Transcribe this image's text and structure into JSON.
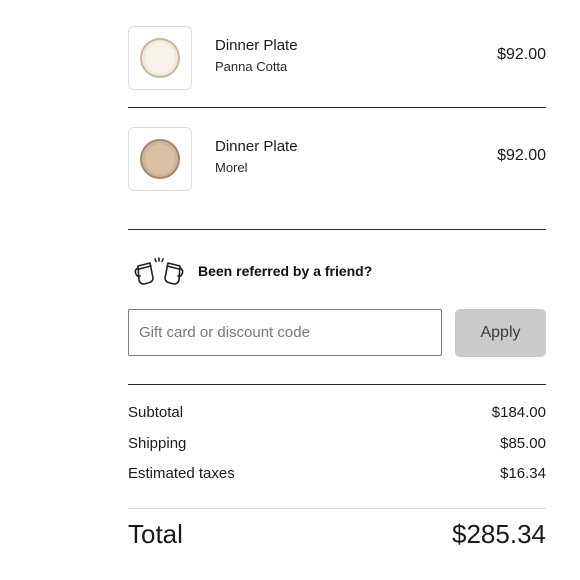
{
  "cart": {
    "items": [
      {
        "name": "Dinner Plate",
        "variant": "Panna Cotta",
        "price": "$92.00"
      },
      {
        "name": "Dinner Plate",
        "variant": "Morel",
        "price": "$92.00"
      }
    ]
  },
  "referral": {
    "text": "Been referred by a friend?",
    "icon": "cheers-mugs-icon"
  },
  "discount": {
    "placeholder": "Gift card or discount code",
    "value": "",
    "apply_label": "Apply"
  },
  "summary": {
    "subtotal_label": "Subtotal",
    "subtotal_value": "$184.00",
    "shipping_label": "Shipping",
    "shipping_value": "$85.00",
    "taxes_label": "Estimated taxes",
    "taxes_value": "$16.34"
  },
  "total": {
    "label": "Total",
    "value": "$285.34"
  },
  "colors": {
    "apply_button_bg": "#cbcbcb",
    "rule": "#2a2a2a"
  }
}
